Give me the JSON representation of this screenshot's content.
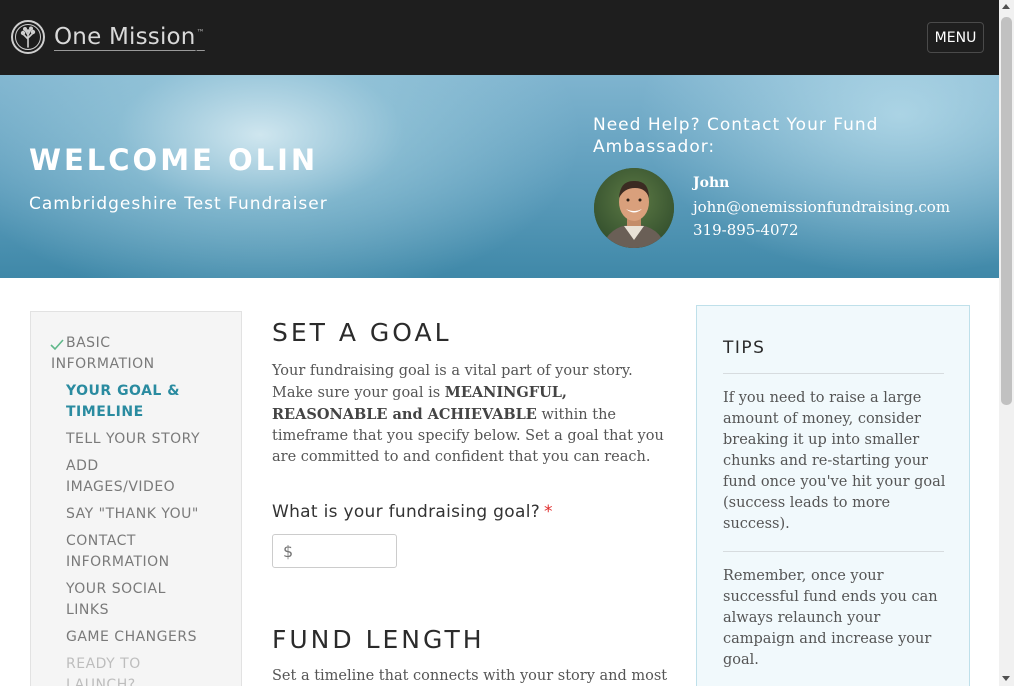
{
  "header": {
    "logo_text": "One Mission",
    "logo_tm": "™",
    "logo_icon": "tree-circle-icon",
    "menu_label": "MENU"
  },
  "hero": {
    "welcome": "WELCOME OLIN",
    "subtitle": "Cambridgeshire Test Fundraiser",
    "help_title": "Need Help? Contact Your Fund Ambassador:",
    "ambassador": {
      "name": "John",
      "email": "john@onemissionfundraising.com",
      "phone": "319-895-4072"
    }
  },
  "sidebar": {
    "items": [
      {
        "label": "BASIC INFORMATION",
        "state": "completed"
      },
      {
        "label": "YOUR GOAL & TIMELINE",
        "state": "active"
      },
      {
        "label": "TELL YOUR STORY",
        "state": "default"
      },
      {
        "label": "ADD IMAGES/VIDEO",
        "state": "default"
      },
      {
        "label": "SAY \"THANK YOU\"",
        "state": "default"
      },
      {
        "label": "CONTACT INFORMATION",
        "state": "default"
      },
      {
        "label": "YOUR SOCIAL LINKS",
        "state": "default"
      },
      {
        "label": "GAME CHANGERS",
        "state": "default"
      },
      {
        "label": "READY TO LAUNCH?",
        "state": "disabled"
      }
    ]
  },
  "main": {
    "goal_heading": "SET A GOAL",
    "goal_para": {
      "part1": "Your fundraising goal is a vital part of your story. Make sure your goal is ",
      "strong": "MEANINGFUL, REASONABLE and ACHIEVABLE",
      "part2": " within the timeframe that you specify below. Set a goal that you are committed to and confident that you can reach."
    },
    "goal_question": "What is your fundraising goal?",
    "required_mark": "*",
    "goal_input": {
      "value": "",
      "placeholder": "$"
    },
    "length_heading": "FUND LENGTH",
    "length_para": "Set a timeline that connects with your story and most"
  },
  "tips": {
    "title": "TIPS",
    "items": [
      "If you need to raise a large amount of money, consider breaking it up into smaller chunks and re-starting your fund once you've hit your goal (success leads to more success).",
      "Remember, once your successful fund ends you can always relaunch your campaign and increase your goal."
    ]
  },
  "colors": {
    "topbar": "#1e1e1e",
    "accent": "#2a8ba0",
    "required": "#e02c2c",
    "tips_bg": "#f1f9fc",
    "check": "#5fb88a"
  }
}
